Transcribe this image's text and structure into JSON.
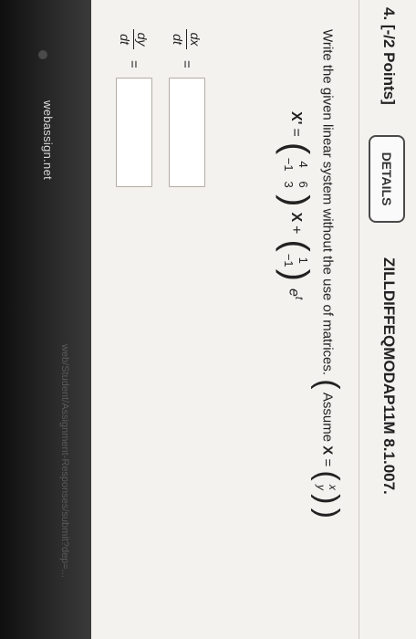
{
  "browser": {
    "url": "webassign.net",
    "faded_path": "web/Student/Assignment-Responses/submit?dep=..."
  },
  "question": {
    "number": "4.",
    "points": "[-/2 Points]",
    "details_label": "DETAILS",
    "code": "ZILLDIFFEQMODAP11M 8.1.007."
  },
  "instruction": {
    "text": "Write the given linear system without the use of matrices.",
    "assume_prefix": "Assume",
    "assume_var": "X",
    "assume_eq": "=",
    "vec_top": "x",
    "vec_bottom": "y"
  },
  "equation": {
    "lhs": "X'",
    "eq": "=",
    "matrix": [
      "4",
      "6",
      "−1",
      "3"
    ],
    "times_x": "X",
    "plus": "+",
    "vec_top": "1",
    "vec_bottom": "−1",
    "exp_base": "e",
    "exp_power": "t"
  },
  "answers": {
    "dx_num": "dx",
    "dx_den": "dt",
    "dy_num": "dy",
    "dy_den": "dt",
    "equals": "="
  }
}
